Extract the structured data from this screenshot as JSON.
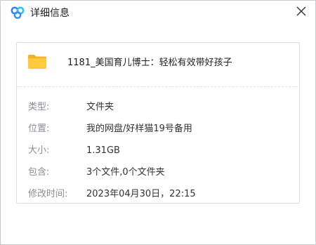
{
  "window": {
    "title": "详细信息",
    "app_icon": "baidu-netdisk-logo-icon",
    "close_icon": "close-icon"
  },
  "file": {
    "icon": "folder-icon",
    "name": "1181_美国育儿博士：轻松有效带好孩子"
  },
  "details": {
    "type": {
      "label": "类型:",
      "value": "文件夹"
    },
    "location": {
      "label": "位置:",
      "value": "我的网盘/好样猫19号备用"
    },
    "size": {
      "label": "大小:",
      "value": "1.31GB"
    },
    "contains": {
      "label": "包含:",
      "value": "3个文件,0个文件夹"
    },
    "modified": {
      "label": "修改时间:",
      "value": "2023年04月30日，22:15"
    }
  },
  "colors": {
    "folder": "#FFC83D",
    "logo_blue": "#2F7BF4",
    "logo_cyan": "#1FC6E8",
    "label_gray": "#8A8D94"
  }
}
